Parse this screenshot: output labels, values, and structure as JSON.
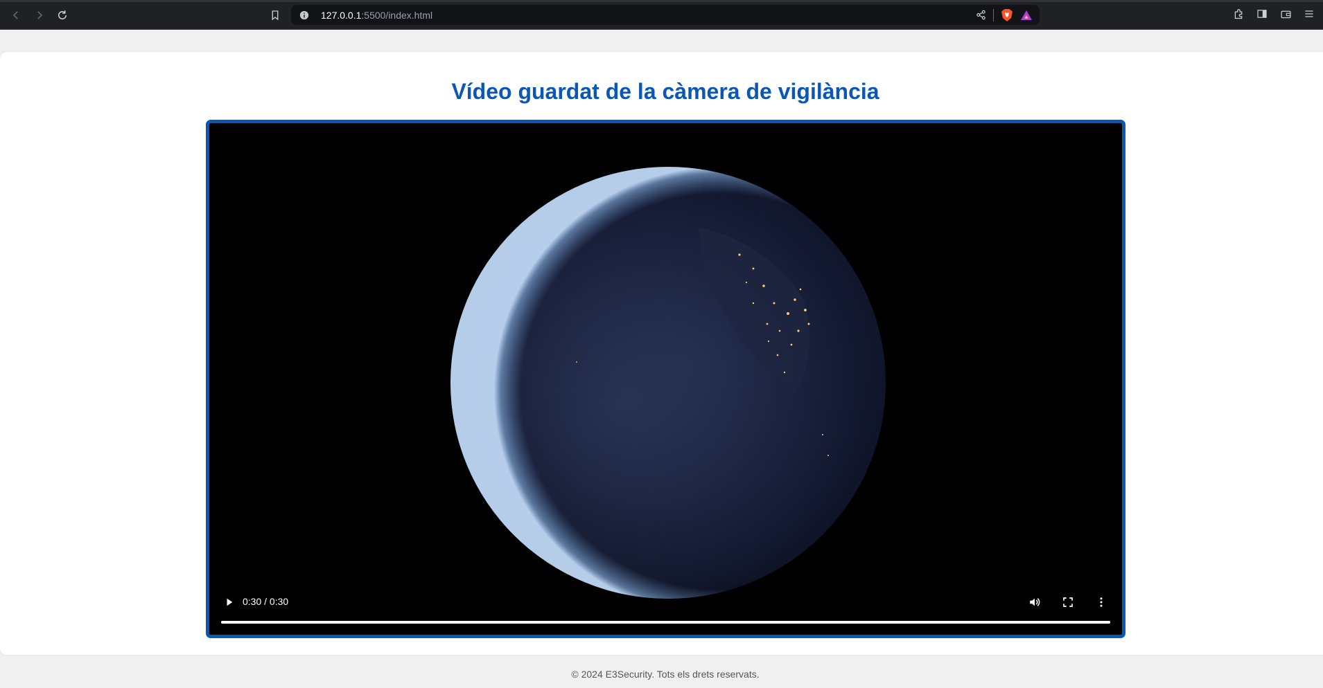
{
  "browser": {
    "url_host": "127.0.0.1",
    "url_rest": ":5500/index.html"
  },
  "page": {
    "title": "Vídeo guardat de la càmera de vigilància",
    "accent_color": "#0b57b5"
  },
  "video": {
    "time_display": "0:30 / 0:30",
    "progress_fraction": 1.0
  },
  "footer": {
    "text": "© 2024 E3Security. Tots els drets reservats."
  },
  "icons": [
    "back-icon",
    "forward-icon",
    "reload-icon",
    "bookmark-icon",
    "info-icon",
    "share-icon",
    "brave-shield-icon",
    "brave-rewards-icon",
    "extensions-icon",
    "sidebar-icon",
    "wallet-icon",
    "menu-icon",
    "play-icon",
    "volume-icon",
    "fullscreen-icon",
    "more-options-icon"
  ]
}
